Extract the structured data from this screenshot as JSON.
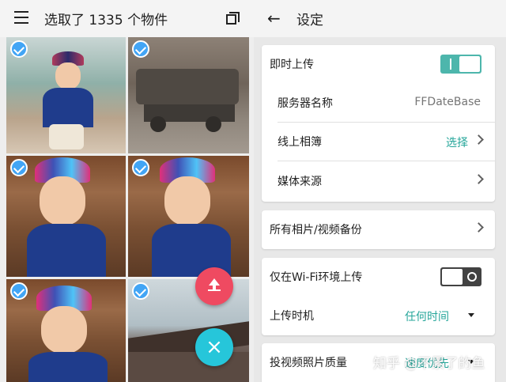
{
  "left": {
    "title": "选取了 1335 个物件",
    "icons": {
      "menu": "menu-icon",
      "select_all": "select-all-icon",
      "checkmark": "check-circle-icon"
    },
    "fab_upload_icon": "upload-icon",
    "fab_close_label": "×"
  },
  "right": {
    "title": "设定",
    "back_glyph": "←",
    "instant_upload": {
      "label": "即时上传",
      "on": true
    },
    "server_name": {
      "label": "服务器名称",
      "value": "FFDateBase"
    },
    "online_album": {
      "label": "线上相簿",
      "value": "选择"
    },
    "media_source": {
      "label": "媒体来源"
    },
    "backup_all": {
      "label": "所有相片/视频备份"
    },
    "wifi_only": {
      "label": "仅在Wi-Fi环境上传",
      "on": false
    },
    "upload_timing": {
      "label": "上传时机",
      "value": "任何时间"
    },
    "video_quality": {
      "label": "投视频照片质量",
      "value": "速度优先"
    }
  },
  "watermark": "知乎 @不累了的鱼",
  "colors": {
    "accent": "#26a69a",
    "fab_upload": "#ef4a61",
    "fab_close": "#26c6da",
    "check": "#42a5f5"
  }
}
